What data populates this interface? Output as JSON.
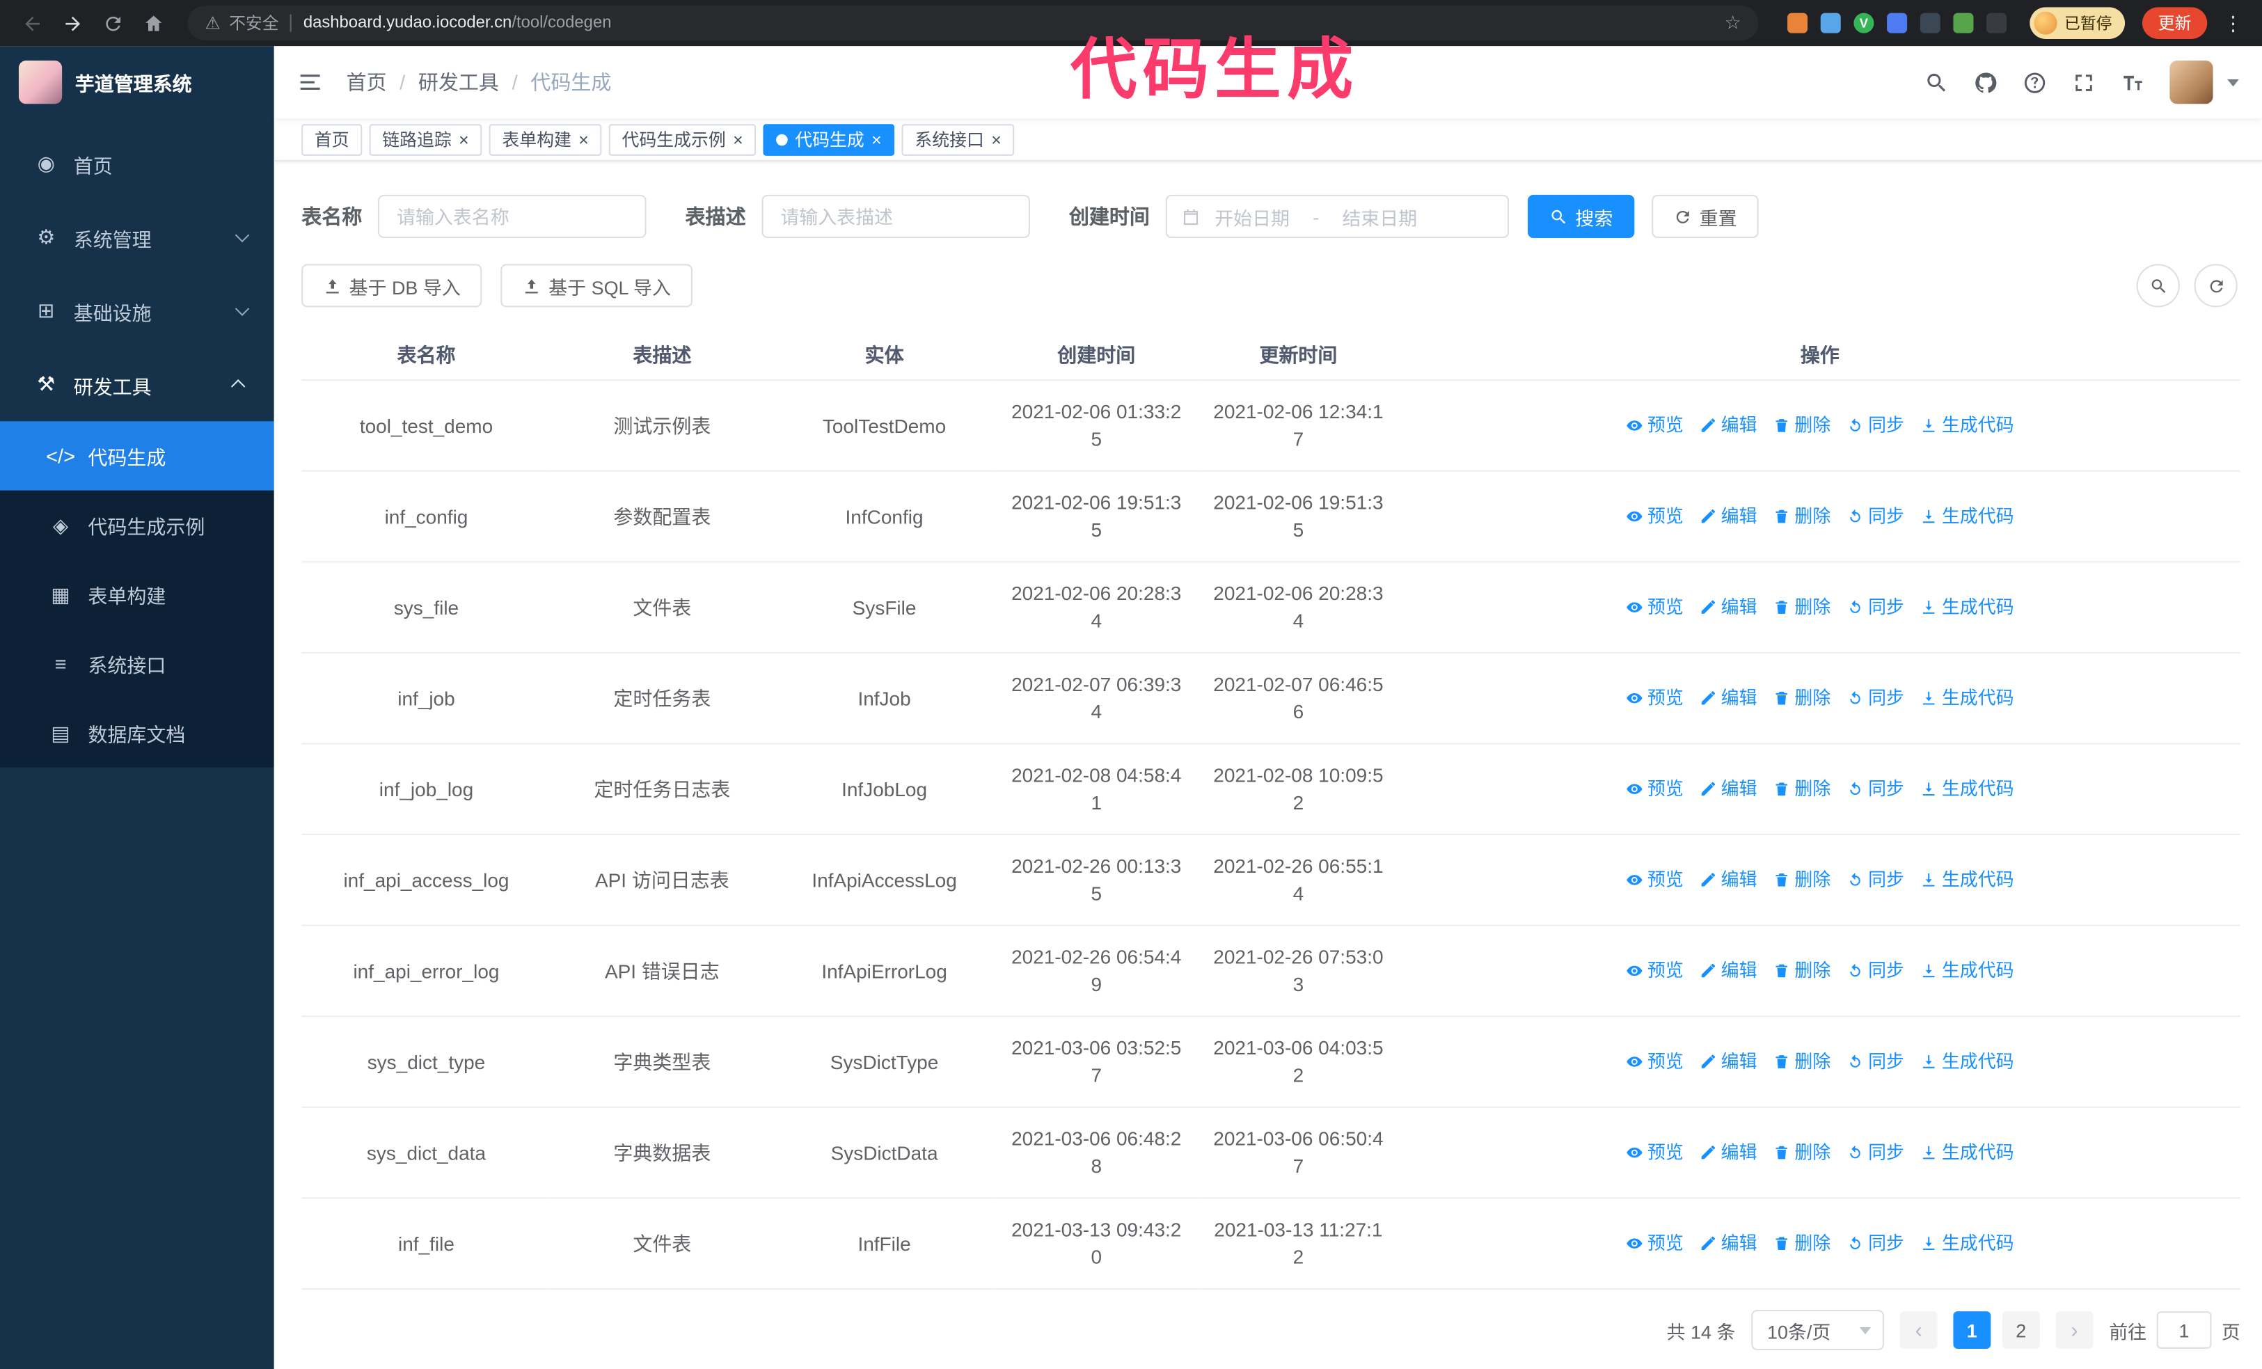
{
  "annotation": {
    "text": "代码生成",
    "color": "#fb3b6b"
  },
  "browser": {
    "security_label": "不安全",
    "url_host": "dashboard.yudao.iocoder.cn",
    "url_path": "/tool/codegen",
    "profile_badge": "已暂停",
    "update_button": "更新",
    "extensions": [
      {
        "name": "extension-icon",
        "color": "#e8833a"
      },
      {
        "name": "extension-icon",
        "color": "#58a6e8"
      },
      {
        "name": "extension-icon",
        "color": "#35b558",
        "shape": "circle",
        "text": "V"
      },
      {
        "name": "extension-icon",
        "color": "#4e7cf0"
      },
      {
        "name": "extension-icon",
        "color": "#3b4754"
      },
      {
        "name": "extension-icon",
        "color": "#57a44c"
      },
      {
        "name": "extension-icon",
        "color": "#383c40"
      }
    ]
  },
  "app": {
    "title": "芋道管理系统"
  },
  "sidebar": {
    "items": [
      {
        "label": "首页",
        "icon": "home-icon",
        "glyph": "◉",
        "type": "top"
      },
      {
        "label": "系统管理",
        "icon": "gear-icon",
        "glyph": "⚙",
        "type": "top",
        "arrow": "down"
      },
      {
        "label": "基础设施",
        "icon": "infrastructure-icon",
        "glyph": "⊞",
        "type": "top",
        "arrow": "down"
      },
      {
        "label": "研发工具",
        "icon": "dev-tools-icon",
        "glyph": "⚒",
        "type": "top",
        "arrow": "up",
        "active_parent": true
      },
      {
        "label": "代码生成",
        "icon": "code-icon",
        "glyph": "</>",
        "type": "sub",
        "active": true
      },
      {
        "label": "代码生成示例",
        "icon": "code-example-icon",
        "glyph": "◈",
        "type": "sub"
      },
      {
        "label": "表单构建",
        "icon": "form-builder-icon",
        "glyph": "▦",
        "type": "sub"
      },
      {
        "label": "系统接口",
        "icon": "api-icon",
        "glyph": "≡",
        "type": "sub"
      },
      {
        "label": "数据库文档",
        "icon": "db-doc-icon",
        "glyph": "▤",
        "type": "sub"
      }
    ]
  },
  "breadcrumb": {
    "items": [
      "首页",
      "研发工具",
      "代码生成"
    ]
  },
  "tags": [
    {
      "label": "首页",
      "closable": false,
      "active": false
    },
    {
      "label": "链路追踪",
      "closable": true,
      "active": false
    },
    {
      "label": "表单构建",
      "closable": true,
      "active": false
    },
    {
      "label": "代码生成示例",
      "closable": true,
      "active": false
    },
    {
      "label": "代码生成",
      "closable": true,
      "active": true
    },
    {
      "label": "系统接口",
      "closable": true,
      "active": false
    }
  ],
  "search": {
    "table_name_label": "表名称",
    "table_name_placeholder": "请输入表名称",
    "table_desc_label": "表描述",
    "table_desc_placeholder": "请输入表描述",
    "create_time_label": "创建时间",
    "date_start_placeholder": "开始日期",
    "date_separator": "-",
    "date_end_placeholder": "结束日期",
    "search_button": "搜索",
    "reset_button": "重置"
  },
  "toolbar": {
    "import_db_button": "基于 DB 导入",
    "import_sql_button": "基于 SQL 导入"
  },
  "table": {
    "columns": [
      "表名称",
      "表描述",
      "实体",
      "创建时间",
      "更新时间",
      "操作"
    ],
    "ops": [
      {
        "label": "预览",
        "icon": "eye-icon",
        "name": "preview-link"
      },
      {
        "label": "编辑",
        "icon": "edit-icon",
        "name": "edit-link"
      },
      {
        "label": "删除",
        "icon": "delete-icon",
        "name": "delete-link"
      },
      {
        "label": "同步",
        "icon": "sync-icon",
        "name": "sync-link"
      },
      {
        "label": "生成代码",
        "icon": "download-icon",
        "name": "generate-code-link"
      }
    ],
    "rows": [
      {
        "name": "tool_test_demo",
        "desc": "测试示例表",
        "entity": "ToolTestDemo",
        "created": "2021-02-06 01:33:25",
        "updated": "2021-02-06 12:34:17"
      },
      {
        "name": "inf_config",
        "desc": "参数配置表",
        "entity": "InfConfig",
        "created": "2021-02-06 19:51:35",
        "updated": "2021-02-06 19:51:35"
      },
      {
        "name": "sys_file",
        "desc": "文件表",
        "entity": "SysFile",
        "created": "2021-02-06 20:28:34",
        "updated": "2021-02-06 20:28:34"
      },
      {
        "name": "inf_job",
        "desc": "定时任务表",
        "entity": "InfJob",
        "created": "2021-02-07 06:39:34",
        "updated": "2021-02-07 06:46:56"
      },
      {
        "name": "inf_job_log",
        "desc": "定时任务日志表",
        "entity": "InfJobLog",
        "created": "2021-02-08 04:58:41",
        "updated": "2021-02-08 10:09:52"
      },
      {
        "name": "inf_api_access_log",
        "desc": "API 访问日志表",
        "entity": "InfApiAccessLog",
        "created": "2021-02-26 00:13:35",
        "updated": "2021-02-26 06:55:14"
      },
      {
        "name": "inf_api_error_log",
        "desc": "API 错误日志",
        "entity": "InfApiErrorLog",
        "created": "2021-02-26 06:54:49",
        "updated": "2021-02-26 07:53:03"
      },
      {
        "name": "sys_dict_type",
        "desc": "字典类型表",
        "entity": "SysDictType",
        "created": "2021-03-06 03:52:57",
        "updated": "2021-03-06 04:03:52"
      },
      {
        "name": "sys_dict_data",
        "desc": "字典数据表",
        "entity": "SysDictData",
        "created": "2021-03-06 06:48:28",
        "updated": "2021-03-06 06:50:47"
      },
      {
        "name": "inf_file",
        "desc": "文件表",
        "entity": "InfFile",
        "created": "2021-03-13 09:43:20",
        "updated": "2021-03-13 11:27:12"
      }
    ]
  },
  "pagination": {
    "total_text": "共 14 条",
    "page_size": "10条/页",
    "pages": [
      "1",
      "2"
    ],
    "active_page": "1",
    "goto_label": "前往",
    "goto_value": "1",
    "goto_suffix": "页"
  }
}
